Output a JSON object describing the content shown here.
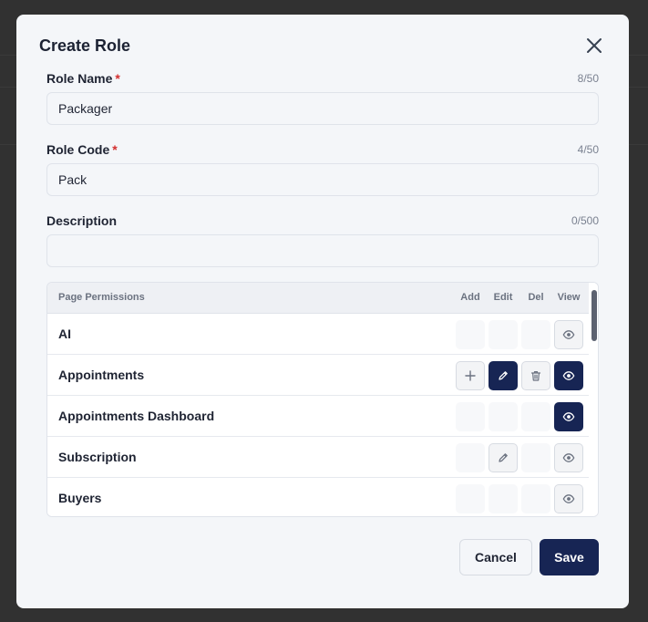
{
  "modal": {
    "title": "Create Role",
    "close_icon": "close-icon"
  },
  "fields": {
    "role_name": {
      "label": "Role Name",
      "required_mark": "*",
      "value": "Packager",
      "counter": "8/50"
    },
    "role_code": {
      "label": "Role Code",
      "required_mark": "*",
      "value": "Pack",
      "counter": "4/50"
    },
    "description": {
      "label": "Description",
      "value": "",
      "counter": "0/500"
    }
  },
  "permissions": {
    "header": {
      "title": "Page Permissions",
      "add": "Add",
      "edit": "Edit",
      "del": "Del",
      "view": "View"
    },
    "rows": [
      {
        "label": "AI",
        "add": "none",
        "edit": "none",
        "del": "none",
        "view": "off"
      },
      {
        "label": "Appointments",
        "add": "off",
        "edit": "on",
        "del": "off",
        "view": "on"
      },
      {
        "label": "Appointments Dashboard",
        "add": "none",
        "edit": "none",
        "del": "none",
        "view": "on"
      },
      {
        "label": "Subscription",
        "add": "none",
        "edit": "off",
        "del": "none",
        "view": "off"
      },
      {
        "label": "Buyers",
        "add": "none",
        "edit": "none",
        "del": "none",
        "view": "off"
      }
    ]
  },
  "actions": {
    "cancel": "Cancel",
    "save": "Save"
  },
  "colors": {
    "accent": "#172554",
    "required": "#d32f2f",
    "overlay": "#313131",
    "modal_bg": "#f4f6f9"
  },
  "icons": {
    "add": "plus-icon",
    "edit": "pencil-icon",
    "del": "trash-icon",
    "view": "eye-icon"
  }
}
